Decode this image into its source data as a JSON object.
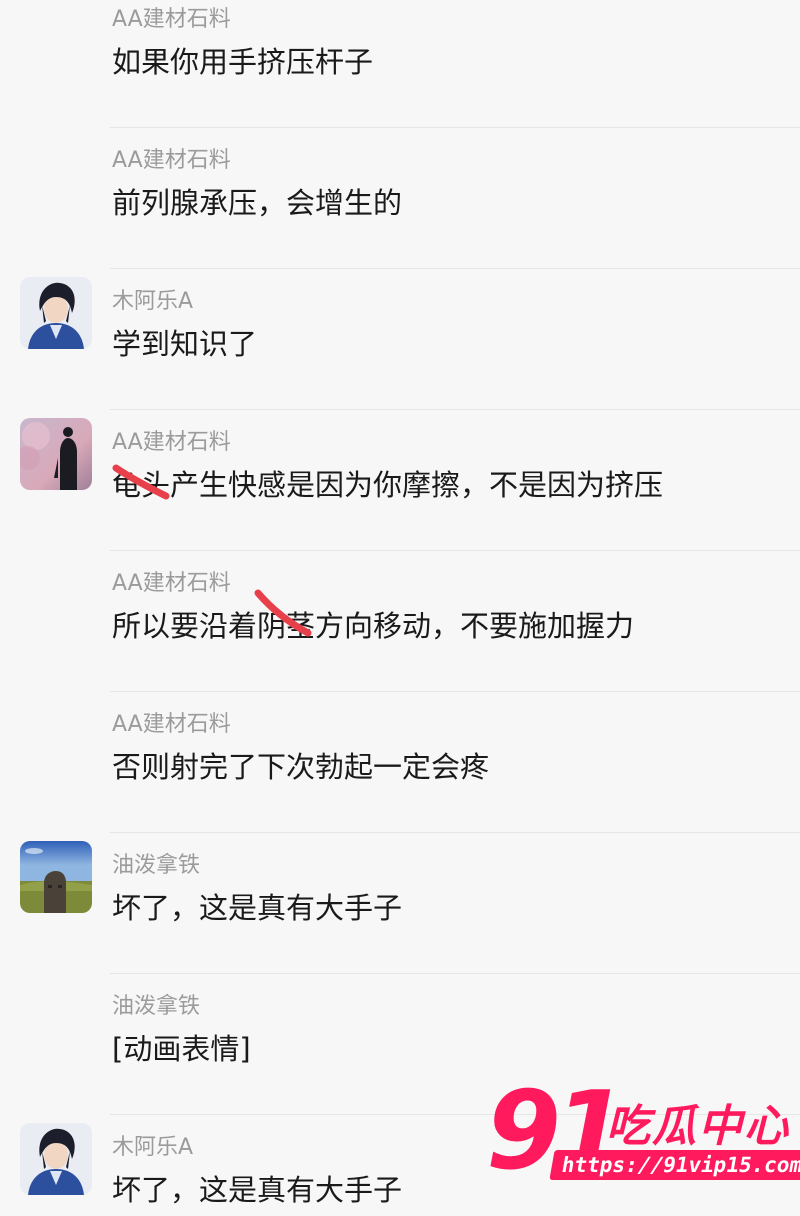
{
  "colors": {
    "background": "#f7f7f7",
    "sender_text": "#9b9b9b",
    "message_text": "#1a1a1a",
    "divider": "#e6e6e6",
    "scribble": "#e8404a",
    "watermark": "#ff1a5e"
  },
  "messages": [
    {
      "sender": "AA建材石料",
      "text": "如果你用手挤压杆子",
      "avatar": null
    },
    {
      "sender": "AA建材石料",
      "text": "前列腺承压，会增生的",
      "avatar": null
    },
    {
      "sender": "木阿乐A",
      "text": "学到知识了",
      "avatar": "anime-boy-avatar"
    },
    {
      "sender": "AA建材石料",
      "text": "龟头产生快感是因为你摩擦，不是因为挤压",
      "avatar": "silhouette-avatar"
    },
    {
      "sender": "AA建材石料",
      "text": "所以要沿着阴茎方向移动，不要施加握力",
      "avatar": null
    },
    {
      "sender": "AA建材石料",
      "text": "否则射完了下次勃起一定会疼",
      "avatar": null
    },
    {
      "sender": "油泼拿铁",
      "text": "坏了，这是真有大手子",
      "avatar": "statue-avatar"
    },
    {
      "sender": "油泼拿铁",
      "text": "[动画表情]",
      "avatar": null
    },
    {
      "sender": "木阿乐A",
      "text": "坏了，这是真有大手子",
      "avatar": "anime-boy-avatar"
    }
  ],
  "watermark": {
    "number": "91",
    "name": "吃瓜中心",
    "url": "https://91vip15.com"
  }
}
